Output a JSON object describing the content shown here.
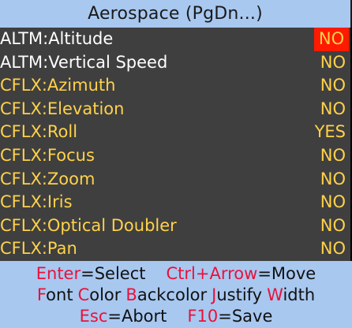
{
  "header": {
    "title": "Aerospace (PgDn...)"
  },
  "menu": {
    "items": [
      {
        "label": "ALTM:Altitude",
        "value": "NO",
        "label_color": "white",
        "selected": true
      },
      {
        "label": "ALTM:Vertical Speed",
        "value": "NO",
        "label_color": "white",
        "selected": false
      },
      {
        "label": "CFLX:Azimuth",
        "value": "NO",
        "label_color": "yellow",
        "selected": false
      },
      {
        "label": "CFLX:Elevation",
        "value": "NO",
        "label_color": "yellow",
        "selected": false
      },
      {
        "label": "CFLX:Roll",
        "value": "YES",
        "label_color": "yellow",
        "selected": false
      },
      {
        "label": "CFLX:Focus",
        "value": "NO",
        "label_color": "yellow",
        "selected": false
      },
      {
        "label": "CFLX:Zoom",
        "value": "NO",
        "label_color": "yellow",
        "selected": false
      },
      {
        "label": "CFLX:Iris",
        "value": "NO",
        "label_color": "yellow",
        "selected": false
      },
      {
        "label": "CFLX:Optical Doubler",
        "value": "NO",
        "label_color": "yellow",
        "selected": false
      },
      {
        "label": "CFLX:Pan",
        "value": "NO",
        "label_color": "yellow",
        "selected": false
      }
    ]
  },
  "footer": {
    "enter_key": "Enter",
    "enter_action": "=Select",
    "ctrl_key": "Ctrl+Arrow",
    "ctrl_action": "=Move",
    "font_f": "F",
    "font_rest": "ont",
    "color_c": "C",
    "color_rest": "olor",
    "backcolor_b": "B",
    "backcolor_rest": "ackcolor",
    "justify_j": "J",
    "justify_rest": "ustify",
    "width_w": "W",
    "width_rest": "idth",
    "esc_key": "Esc",
    "esc_action": "=Abort",
    "f10_key": "F10",
    "f10_action": "=Save"
  },
  "colors": {
    "header_bg": "#a8c8f0",
    "row_bg": "#3f3f3f",
    "label_white": "#ffffff",
    "label_yellow": "#ffd24a",
    "selected_bg": "#ff1a00",
    "footer_key": "#e8123a",
    "footer_text": "#111111"
  }
}
